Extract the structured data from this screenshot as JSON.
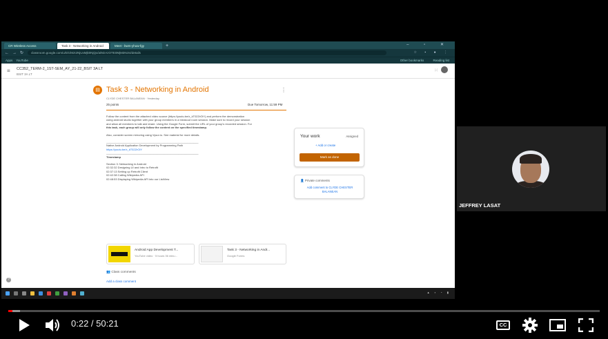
{
  "browser": {
    "tabs": [
      {
        "label": "CR Wireless Access"
      },
      {
        "label": "Task 3 - Networking in Android"
      },
      {
        "label": "Meet - bwm-yhuw-fgy"
      }
    ],
    "url": "classroom.google.com/u/0/c/MzI2NjUxMjk0NjQx/a/MzAzOTE0MjM3NzI4/details",
    "bookmarks": [
      "Apps",
      "YouTube"
    ],
    "bookmarks_right": [
      "Other bookmarks",
      "Reading list"
    ]
  },
  "classroom": {
    "course_title": "CC352_TERM-2_1ST-SEM_AY_21-22_BSIT 3A LT",
    "course_section": "BSIT 3A LT",
    "task": {
      "title": "Task 3 - Networking in Android",
      "author": "CLYDE CHESTER BALANEAN · Yesterday",
      "points": "25 points",
      "due": "Due Tomorrow, 11:59 PM",
      "lines": [
        "Follow the content from the attached video source (https://youtu.be/x_kT02ZrOiY) and perform the demonstration",
        "using android studio together with your group members in a breakout room session. Make sure to record your session",
        "and allow all members to talk and share. Using the Google Form, submit the URL of your group's recorded session. For",
        "this task, each group will only follow the content on the specified timestamp.",
        "",
        "Also, consider screen mirroring using Vysor.io. See material for more details.",
        "",
        "____________________________________________________________",
        "Native Android Application Development by Programming Path",
        "https://youtu.be/x_kT02ZrOiY",
        "____________________________________________________________",
        "Timestamp",
        "",
        "Section 3: Networking in Android",
        "02:32:32 Designing UI and Intro to Retrofit",
        "02:37:13 Setting up Retrofit Client",
        "02:42:38 Calling Wikipedia API",
        "02:48:53 Displaying Wikipedia API into our ListView"
      ]
    },
    "attachments": [
      {
        "title": "Android App Development T...",
        "subtitle": "YouTube video · 5 hours 36 minu..."
      },
      {
        "title": "Task 3 - Networking in Andr...",
        "subtitle": "Google Forms"
      }
    ],
    "class_comments": "Class comments",
    "add_class_comment": "Add a class comment",
    "your_work": {
      "title": "Your work",
      "status": "Assigned",
      "add_create": "+ Add or create",
      "mark_done": "Mark as done"
    },
    "private_comments": {
      "title": "Private comments",
      "link": "Add comment to CLYDE CHESTER BALANEAN"
    }
  },
  "webcam": {
    "name": "JEFFREY LASAT"
  },
  "player": {
    "current_time": "0:22",
    "duration": "50:21",
    "time_text": "0:22 / 50:21",
    "progress_fraction": 0.0073,
    "loaded_fraction": 0.02,
    "accent": "#ff0000",
    "icons": [
      "play-icon",
      "volume-icon",
      "captions-icon",
      "gear-icon",
      "miniplayer-icon",
      "fullscreen-icon"
    ]
  }
}
